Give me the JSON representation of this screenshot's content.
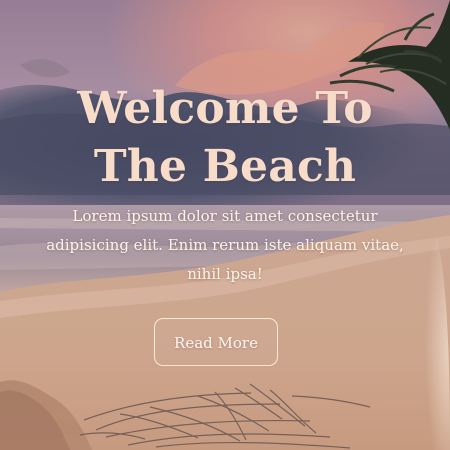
{
  "hero": {
    "title": "Welcome To The Beach",
    "subtitle": "Lorem ipsum dolor sit amet consectetur adipisicing elit. Enim rerum iste aliquam vitae, nihil ipsa!",
    "button_label": "Read More"
  },
  "colors": {
    "title_text": "#f6dcc9",
    "subtitle_text": "#fff3e9",
    "button_border": "#ffebdc",
    "sky_top": "#a78ea6",
    "storm_cloud": "#4b4f6a",
    "sand": "#d6ab8f"
  },
  "icons": {
    "palm": "palm-tree-icon"
  }
}
